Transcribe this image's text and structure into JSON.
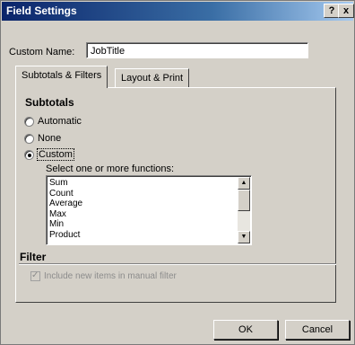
{
  "window": {
    "title": "Field Settings",
    "help_btn": "?",
    "close_btn": "x"
  },
  "custom_name": {
    "label": "Custom Name:",
    "value": "JobTitle"
  },
  "tabs": [
    {
      "label": "Subtotals & Filters",
      "active": true
    },
    {
      "label": "Layout & Print",
      "active": false
    }
  ],
  "subtotals": {
    "title": "Subtotals",
    "options": [
      {
        "label": "Automatic",
        "selected": false
      },
      {
        "label": "None",
        "selected": false
      },
      {
        "label": "Custom",
        "selected": true
      }
    ],
    "functions_label": "Select one or more functions:",
    "functions": [
      "Sum",
      "Count",
      "Average",
      "Max",
      "Min",
      "Product"
    ]
  },
  "filter": {
    "title": "Filter",
    "checkbox_label": "Include new items in manual filter",
    "checked": true,
    "disabled": true
  },
  "buttons": {
    "ok": "OK",
    "cancel": "Cancel"
  }
}
